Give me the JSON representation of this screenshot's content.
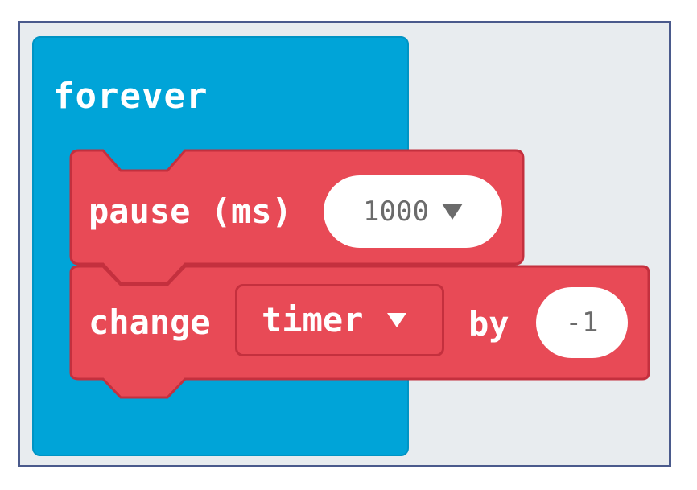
{
  "forever": {
    "label": "forever"
  },
  "pause_block": {
    "label": "pause (ms)",
    "value": "1000",
    "dropdown_icon": "triangle-down-icon"
  },
  "change_block": {
    "label": "change",
    "variable": "timer",
    "by_label": "by",
    "amount": "-1",
    "dropdown_icon": "triangle-down-icon"
  },
  "colors": {
    "forever_block": "#00a4d8",
    "variables_block": "#e84a56",
    "variables_block_border": "#c4303e",
    "workspace": "#e8ecef",
    "frame_border": "#4a5a8c",
    "value_text": "#6b6b6b"
  }
}
